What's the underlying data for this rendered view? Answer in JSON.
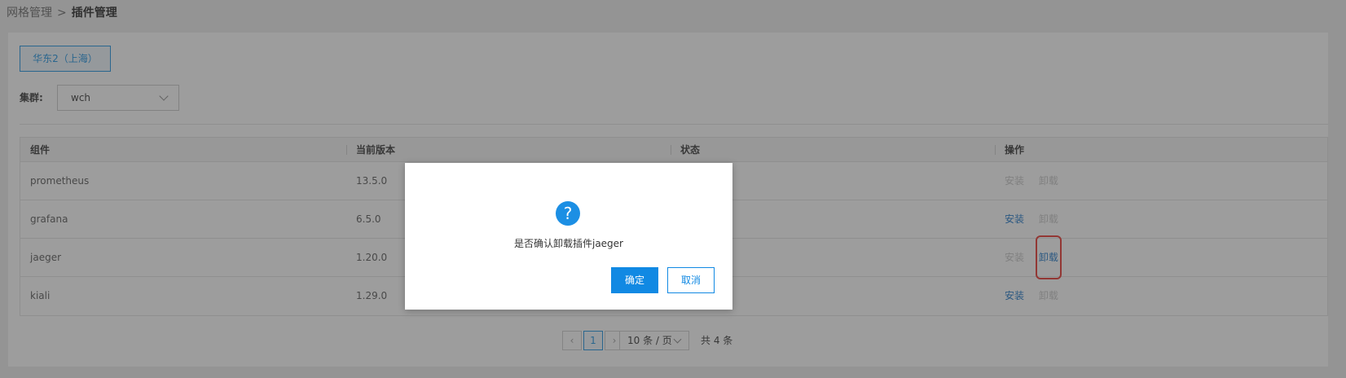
{
  "breadcrumb": {
    "parent": "网格管理",
    "separator": ">",
    "current": "插件管理"
  },
  "region": {
    "label": "华东2（上海）"
  },
  "cluster": {
    "label": "集群:",
    "value": "wch"
  },
  "table": {
    "headers": [
      "组件",
      "当前版本",
      "状态",
      "操作"
    ],
    "rows": [
      {
        "name": "prometheus",
        "version": "13.5.0",
        "status": "",
        "install": "安装",
        "uninstall": "卸载"
      },
      {
        "name": "grafana",
        "version": "6.5.0",
        "status": "",
        "install": "安装",
        "uninstall": "卸载"
      },
      {
        "name": "jaeger",
        "version": "1.20.0",
        "status": "",
        "install": "安装",
        "uninstall": "卸载"
      },
      {
        "name": "kiali",
        "version": "1.29.0",
        "status": "",
        "install": "安装",
        "uninstall": "卸载"
      }
    ]
  },
  "pagination": {
    "prev": "‹",
    "current_page": "1",
    "next": "›",
    "page_size": "10 条 / 页",
    "total": "共 4 条"
  },
  "dialog": {
    "icon": "question-icon",
    "message": "是否确认卸载插件jaeger",
    "confirm": "确定",
    "cancel": "取消"
  },
  "colors": {
    "accent": "#1189e3",
    "highlight": "#e8332d",
    "disabled": "#c4c4c4"
  }
}
